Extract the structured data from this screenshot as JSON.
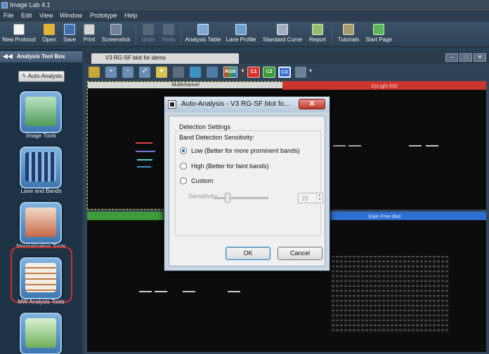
{
  "app": {
    "title": "Image Lab 4.1"
  },
  "menu": [
    "File",
    "Edit",
    "View",
    "Window",
    "Prototype",
    "Help"
  ],
  "toolbar": {
    "new_protocol": "New Protocol",
    "open": "Open",
    "save": "Save",
    "print": "Print",
    "screenshot": "Screenshot",
    "undo": "Undo",
    "redo": "Redo",
    "analysis_table": "Analysis Table",
    "lane_profile": "Lane Profile",
    "standard_curve": "Standard Curve",
    "report": "Report",
    "tutorials": "Tutorials",
    "start_page": "Start Page"
  },
  "sidebar": {
    "header": "Analysis Tool Box",
    "auto_analysis": "Auto-Analysis",
    "tools": [
      "Image Tools",
      "Lane and Bands",
      "Normalization Tools",
      "MW Analysis Tools"
    ],
    "highlighted": "Normalization Tools"
  },
  "document": {
    "tab": "V3 RG-SF blot for demo",
    "channel_buttons": [
      "RGB",
      "C1",
      "C2",
      "C3"
    ],
    "panels": [
      "Multichannel",
      "DyLight 630",
      "",
      "Stain Free Blot"
    ]
  },
  "dialog": {
    "title": "Auto-Analysis - V3 RG-SF blot fo...",
    "close": "✕",
    "section": "Detection Settings",
    "sensitivity_label": "Band Detection Sensitivity:",
    "options": [
      "Low (Better for more prominent bands)",
      "High (Better for faint bands)",
      "Custom:"
    ],
    "selected_option": 0,
    "sensitivity_field_label": "Sensitivity:",
    "sensitivity_value": "25",
    "slider_level": 0.25,
    "ok": "OK",
    "cancel": "Cancel"
  },
  "colors": {
    "accent_red": "#d9342b",
    "accent_green": "#3f9a3a",
    "accent_blue": "#2f6fd1",
    "highlight_ring": "#c8302a"
  }
}
